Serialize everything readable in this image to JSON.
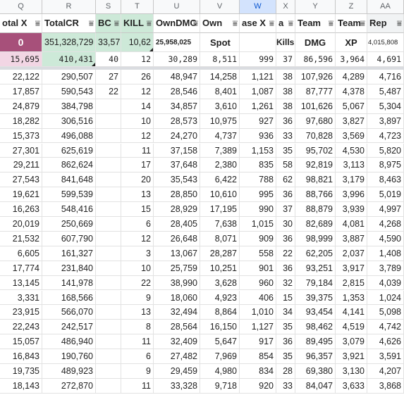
{
  "columns": [
    "Q",
    "R",
    "S",
    "T",
    "U",
    "V",
    "W",
    "X",
    "Y",
    "Z",
    "AA"
  ],
  "selected_column": "W",
  "headers": [
    "otal X",
    "TotalCR",
    "BC",
    "KILL",
    "OwnDMC",
    "Own",
    "ase X",
    "a",
    "Team",
    "Team",
    "Rep"
  ],
  "row2": [
    "0",
    "351,328,729",
    "33,57",
    "10,62",
    "25,958,025",
    "Spot",
    "",
    "Kills",
    "DMG",
    "XP",
    "4,015,808"
  ],
  "row3": [
    "15,695",
    "410,431",
    "40",
    "12",
    "30,289",
    "8,511",
    "999",
    "37",
    "86,596",
    "3,964",
    "4,691"
  ],
  "rows": [
    [
      "22,122",
      "290,507",
      "27",
      "26",
      "48,947",
      "14,258",
      "1,121",
      "38",
      "107,926",
      "4,289",
      "4,716"
    ],
    [
      "17,857",
      "590,543",
      "22",
      "12",
      "28,546",
      "8,401",
      "1,087",
      "38",
      "87,777",
      "4,378",
      "5,487"
    ],
    [
      "24,879",
      "384,798",
      "",
      "14",
      "34,857",
      "3,610",
      "1,261",
      "38",
      "101,626",
      "5,067",
      "5,304"
    ],
    [
      "18,282",
      "306,516",
      "",
      "10",
      "28,573",
      "10,975",
      "927",
      "36",
      "97,680",
      "3,827",
      "3,897"
    ],
    [
      "15,373",
      "496,088",
      "",
      "12",
      "24,270",
      "4,737",
      "936",
      "33",
      "70,828",
      "3,569",
      "4,723"
    ],
    [
      "27,301",
      "625,619",
      "",
      "11",
      "37,158",
      "7,389",
      "1,153",
      "35",
      "95,702",
      "4,530",
      "5,820"
    ],
    [
      "29,211",
      "862,624",
      "",
      "17",
      "37,648",
      "2,380",
      "835",
      "58",
      "92,819",
      "3,113",
      "8,975"
    ],
    [
      "27,543",
      "841,648",
      "",
      "20",
      "35,543",
      "6,422",
      "788",
      "62",
      "98,821",
      "3,179",
      "8,463"
    ],
    [
      "19,621",
      "599,539",
      "",
      "13",
      "28,850",
      "10,610",
      "995",
      "36",
      "88,766",
      "3,996",
      "5,019"
    ],
    [
      "16,263",
      "548,416",
      "",
      "15",
      "28,929",
      "17,195",
      "990",
      "37",
      "88,879",
      "3,939",
      "4,997"
    ],
    [
      "20,019",
      "250,669",
      "",
      "6",
      "28,405",
      "7,638",
      "1,015",
      "30",
      "82,689",
      "4,081",
      "4,268"
    ],
    [
      "21,532",
      "607,790",
      "",
      "12",
      "26,648",
      "8,071",
      "909",
      "36",
      "98,999",
      "3,887",
      "4,590"
    ],
    [
      "6,605",
      "161,327",
      "",
      "3",
      "13,067",
      "28,287",
      "558",
      "22",
      "62,205",
      "2,037",
      "1,408"
    ],
    [
      "17,774",
      "231,840",
      "",
      "10",
      "25,759",
      "10,251",
      "901",
      "36",
      "93,251",
      "3,917",
      "3,789"
    ],
    [
      "13,145",
      "141,978",
      "",
      "22",
      "38,990",
      "3,628",
      "960",
      "32",
      "79,184",
      "2,815",
      "4,039"
    ],
    [
      "3,331",
      "168,566",
      "",
      "9",
      "18,060",
      "4,923",
      "406",
      "15",
      "39,375",
      "1,353",
      "1,024"
    ],
    [
      "23,915",
      "566,070",
      "",
      "13",
      "32,494",
      "8,864",
      "1,010",
      "34",
      "93,454",
      "4,141",
      "5,098"
    ],
    [
      "22,243",
      "242,517",
      "",
      "8",
      "28,564",
      "16,150",
      "1,127",
      "35",
      "98,462",
      "4,519",
      "4,742"
    ],
    [
      "15,057",
      "486,940",
      "",
      "11",
      "32,409",
      "5,647",
      "917",
      "36",
      "89,495",
      "3,079",
      "4,626"
    ],
    [
      "16,843",
      "190,760",
      "",
      "6",
      "27,482",
      "7,969",
      "854",
      "35",
      "96,357",
      "3,921",
      "3,591"
    ],
    [
      "19,735",
      "489,923",
      "",
      "9",
      "29,459",
      "4,980",
      "834",
      "28",
      "69,380",
      "3,130",
      "4,207"
    ],
    [
      "18,143",
      "272,870",
      "",
      "11",
      "33,328",
      "9,718",
      "920",
      "33",
      "84,047",
      "3,633",
      "3,868"
    ]
  ],
  "colors": {
    "header_green": "#cde9d8",
    "purple": "#a7507a",
    "pink": "#f2d6e4",
    "selected": "#d3e3fd"
  },
  "filter_icon": "filter-icon"
}
